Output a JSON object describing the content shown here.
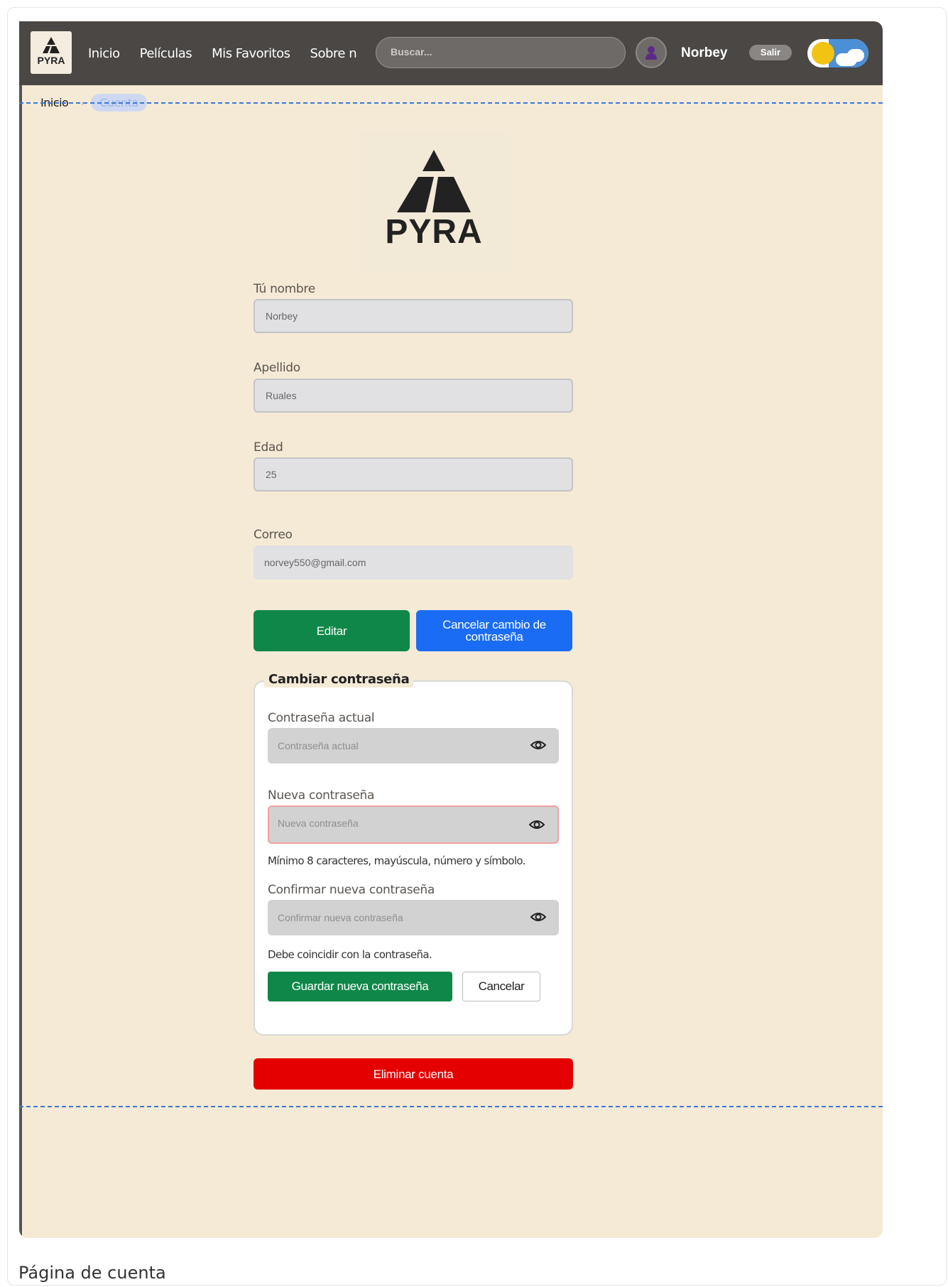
{
  "navbar": {
    "logo_text": "PYRA",
    "links": [
      "Inicio",
      "Películas",
      "Mis Favoritos",
      "Sobre nosotros"
    ],
    "search_placeholder": "Buscar...",
    "user_name": "Norbey",
    "logout_label": "Salir",
    "theme_toggle_icon": "sun-cloud-toggle-icon"
  },
  "breadcrumb": {
    "items": [
      "Inicio",
      "Cuenta"
    ],
    "separator": "›"
  },
  "logo": {
    "text": "PYRA"
  },
  "form": {
    "name_label": "Tú nombre",
    "name_value": "Norbey",
    "lastname_label": "Apellido",
    "lastname_value": "Ruales",
    "age_label": "Edad",
    "age_value": "25",
    "email_label": "Correo",
    "email_value": "norvey550@gmail.com",
    "edit_button": "Editar",
    "cancel_pw_change_button": "Cancelar cambio de contraseña"
  },
  "password_section": {
    "legend": "Cambiar contraseña",
    "current_label": "Contraseña actual",
    "current_placeholder": "Contraseña actual",
    "new_label": "Nueva contraseña",
    "new_placeholder": "Nueva contraseña",
    "new_hint": "Mínimo 8 caracteres, mayúscula, número y símbolo.",
    "confirm_label": "Confirmar nueva contraseña",
    "confirm_placeholder": "Confirmar nueva contraseña",
    "confirm_hint": "Debe coincidir con la contraseña.",
    "save_button": "Guardar nueva contraseña",
    "cancel_button": "Cancelar"
  },
  "delete_button": "Eliminar cuenta",
  "caption": "Página de cuenta",
  "colors": {
    "background": "#f5ead6",
    "navbar": "#4a4745",
    "green": "#0f8748",
    "blue": "#1a6cf5",
    "red": "#e40000",
    "breadcrumb_active": "#9bb6ee",
    "dashed": "#3b78d8"
  }
}
